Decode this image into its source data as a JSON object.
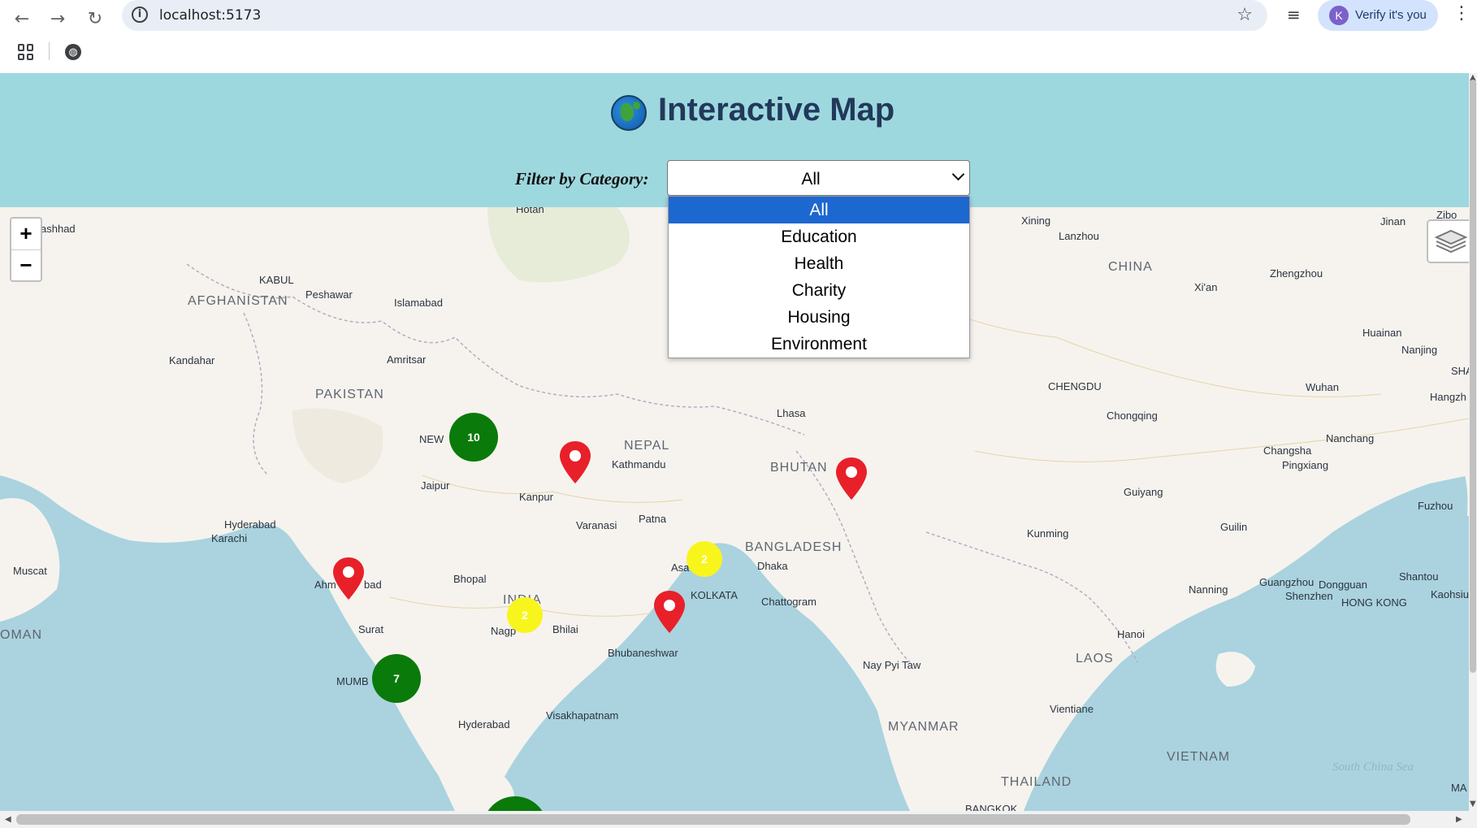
{
  "browser": {
    "url": "localhost:5173",
    "profile_label": "Verify it's you",
    "profile_initial": "K"
  },
  "header": {
    "title": "Interactive Map",
    "filter_label": "Filter by Category:",
    "selected_category": "All"
  },
  "dropdown": {
    "options": [
      "All",
      "Education",
      "Health",
      "Charity",
      "Housing",
      "Environment"
    ],
    "selected_index": 0
  },
  "map": {
    "zoom_in": "+",
    "zoom_out": "−",
    "clusters": [
      {
        "count": "10",
        "color": "green"
      },
      {
        "count": "7",
        "color": "green"
      },
      {
        "count": "2",
        "color": "yellow"
      },
      {
        "count": "2",
        "color": "yellow"
      },
      {
        "count": "",
        "color": "green"
      }
    ],
    "labels": {
      "mashhad": "ashhad",
      "kabul": "KABUL",
      "peshawar": "Peshawar",
      "islamabad": "Islamabad",
      "afghanistan": "AFGHANISTAN",
      "kandahar": "Kandahar",
      "amritsar": "Amritsar",
      "pakistan": "PAKISTAN",
      "new_delhi": "NEW",
      "jaipur": "Jaipur",
      "kanpur": "Kanpur",
      "nepal": "NEPAL",
      "kathmandu": "Kathmandu",
      "varanasi": "Varanasi",
      "patna": "Patna",
      "bhutan": "BHUTAN",
      "lhasa": "Lhasa",
      "hyderabad_pk": "Hyderabad",
      "karachi": "Karachi",
      "muscat": "Muscat",
      "oman": "OMAN",
      "ahmedabad_a": "Ahm",
      "ahmedabad_b": "bad",
      "bhopal": "Bhopal",
      "india": "INDIA",
      "surat": "Surat",
      "nagpur": "Nagp",
      "bhilai": "Bhilai",
      "asansol": "Asa",
      "kolkata": "KOLKATA",
      "dhaka": "Dhaka",
      "bangladesh": "BANGLADESH",
      "chattogram": "Chattogram",
      "bhubaneshwar": "Bhubaneshwar",
      "mumbai": "MUMB",
      "hyderabad_in": "Hyderabad",
      "visakhapatnam": "Visakhapatnam",
      "nay_pyi_taw": "Nay Pyi Taw",
      "myanmar": "MYANMAR",
      "bangkok": "BANGKOK",
      "thailand": "THAILAND",
      "laos": "LAOS",
      "vientiane": "Vientiane",
      "hanoi": "Hanoi",
      "vietnam": "VIETNAM",
      "nanning": "Nanning",
      "kunming": "Kunming",
      "guilin": "Guilin",
      "guiyang": "Guiyang",
      "chongqing": "Chongqing",
      "chengdu": "CHENGDU",
      "xining": "Xining",
      "lanzhou": "Lanzhou",
      "china": "CHINA",
      "xian": "Xi'an",
      "zhengzhou": "Zhengzhou",
      "jinan": "Jinan",
      "zibo": "Zibo",
      "huainan": "Huainan",
      "nanjing": "Nanjing",
      "sha": "SHA",
      "wuhan": "Wuhan",
      "hangzhou": "Hangzh",
      "changsha": "Changsha",
      "nanchang": "Nanchang",
      "pingxiang": "Pingxiang",
      "fuzhou": "Fuzhou",
      "guangzhou": "Guangzhou",
      "dongguan": "Dongguan",
      "shenzhen": "Shenzhen",
      "hong_kong": "HONG KONG",
      "shantou": "Shantou",
      "kaohsiung": "Kaohsiu",
      "ma": "MA",
      "hotan": "Hotan",
      "south_china_sea": "South China Sea"
    }
  }
}
